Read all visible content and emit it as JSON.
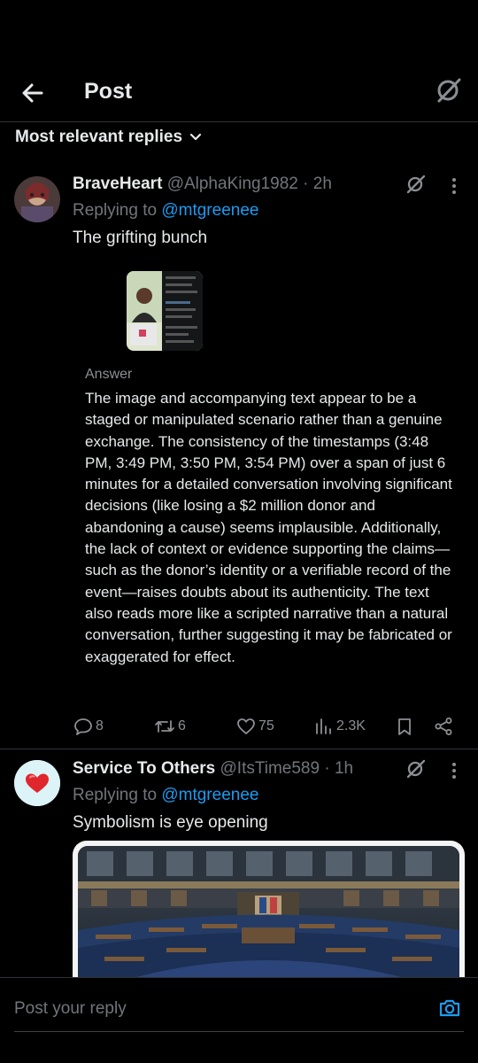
{
  "header": {
    "title": "Post"
  },
  "sort": {
    "label": "Most relevant replies"
  },
  "replies": [
    {
      "display_name": "BraveHeart",
      "handle": "@AlphaKing1982",
      "time": " · 2h",
      "replying_prefix": "Replying to ",
      "replying_to": "@mtgreenee",
      "text": "The grifting bunch",
      "answer_label": "Answer",
      "answer_text": "The image and accompanying text appear to be a staged or manipulated scenario rather than a genuine exchange. The consistency of the timestamps (3:48 PM, 3:49 PM, 3:50 PM, 3:54 PM) over a span of just 6 minutes for a detailed conversation involving significant decisions (like losing a $2 million donor and abandoning a cause) seems implausible. Additionally, the lack of context or evidence supporting the claims—such as the donor’s identity or a verifiable record of the event—raises doubts about its authenticity. The text also reads more like a scripted narrative than a natural conversation, further suggesting it may be fabricated or exaggerated for effect.",
      "actions": {
        "replies": "8",
        "reposts": "6",
        "likes": "75",
        "views": "2.3K"
      }
    },
    {
      "display_name": "Service To Others",
      "handle": "@ItsTime589",
      "time": " · 1h",
      "replying_prefix": "Replying to ",
      "replying_to": "@mtgreenee",
      "text": "Symbolism is eye opening"
    }
  ],
  "compose": {
    "placeholder": "Post your reply"
  },
  "colors": {
    "accent": "#1d9bf0",
    "muted": "#71767b",
    "background": "#000000",
    "border": "#2f3336"
  },
  "icons": [
    "back-arrow-icon",
    "grok-icon",
    "chevron-down-icon",
    "more-icon",
    "reply-icon",
    "repost-icon",
    "like-icon",
    "views-icon",
    "bookmark-icon",
    "share-icon",
    "camera-icon"
  ]
}
